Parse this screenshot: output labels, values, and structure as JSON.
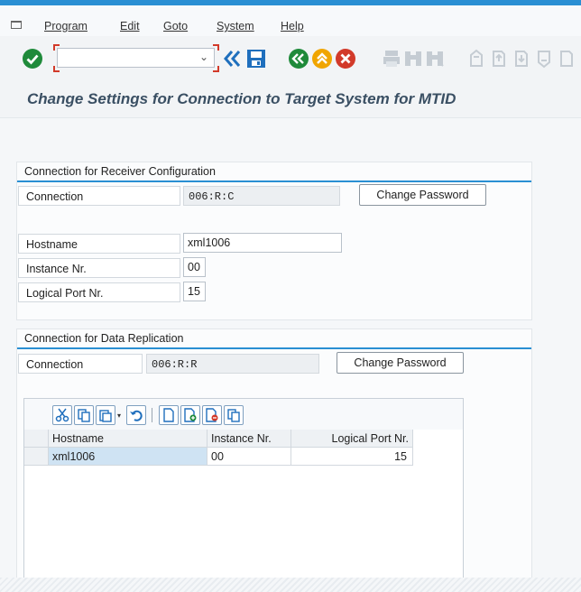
{
  "menu": {
    "items": [
      "Program",
      "Edit",
      "Goto",
      "System",
      "Help"
    ]
  },
  "toolbar": {
    "command_field_value": "",
    "icons": [
      "enter-icon",
      "back-double-icon",
      "save-icon",
      "back-icon",
      "exit-icon",
      "cancel-icon",
      "print-icon",
      "find-icon",
      "find-next-icon",
      "first-page-icon",
      "prev-page-icon",
      "next-page-icon",
      "last-page-icon"
    ]
  },
  "page": {
    "title": "Change Settings for Connection to Target System for MTID"
  },
  "receiver_config": {
    "title": "Connection for Receiver Configuration",
    "connection_label": "Connection",
    "connection_value": "006:R:C",
    "change_password_label": "Change Password",
    "hostname_label": "Hostname",
    "hostname_value": "xml1006",
    "instance_label": "Instance Nr.",
    "instance_value": "00",
    "logical_port_label": "Logical Port Nr.",
    "logical_port_value": "15"
  },
  "data_replication": {
    "title": "Connection for Data Replication",
    "connection_label": "Connection",
    "connection_value": "006:R:R",
    "change_password_label": "Change Password",
    "table": {
      "columns": [
        "Hostname",
        "Instance Nr.",
        "Logical Port Nr."
      ],
      "rows": [
        [
          "xml1006",
          "00",
          "15"
        ]
      ]
    }
  },
  "colors": {
    "accent": "#2a8fd3",
    "title": "#3a4f63",
    "green": "#1f8a3a",
    "orange": "#f0a500",
    "red": "#d23a2a"
  }
}
